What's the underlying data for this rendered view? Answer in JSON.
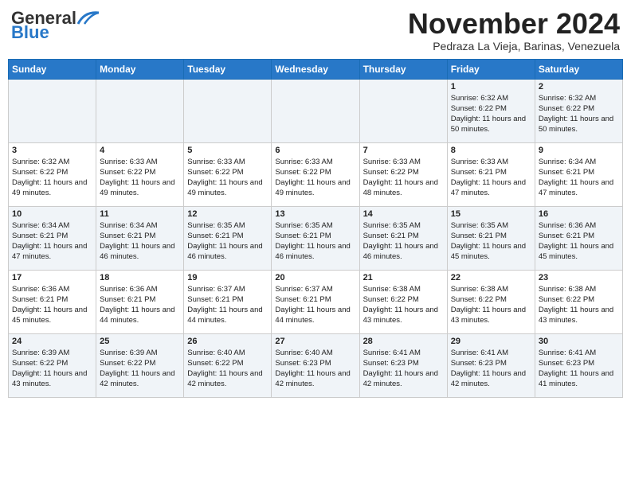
{
  "header": {
    "logo_line1": "General",
    "logo_line2": "Blue",
    "month_title": "November 2024",
    "location": "Pedraza La Vieja, Barinas, Venezuela"
  },
  "days_of_week": [
    "Sunday",
    "Monday",
    "Tuesday",
    "Wednesday",
    "Thursday",
    "Friday",
    "Saturday"
  ],
  "weeks": [
    [
      {
        "day": "",
        "info": ""
      },
      {
        "day": "",
        "info": ""
      },
      {
        "day": "",
        "info": ""
      },
      {
        "day": "",
        "info": ""
      },
      {
        "day": "",
        "info": ""
      },
      {
        "day": "1",
        "info": "Sunrise: 6:32 AM\nSunset: 6:22 PM\nDaylight: 11 hours and 50 minutes."
      },
      {
        "day": "2",
        "info": "Sunrise: 6:32 AM\nSunset: 6:22 PM\nDaylight: 11 hours and 50 minutes."
      }
    ],
    [
      {
        "day": "3",
        "info": "Sunrise: 6:32 AM\nSunset: 6:22 PM\nDaylight: 11 hours and 49 minutes."
      },
      {
        "day": "4",
        "info": "Sunrise: 6:33 AM\nSunset: 6:22 PM\nDaylight: 11 hours and 49 minutes."
      },
      {
        "day": "5",
        "info": "Sunrise: 6:33 AM\nSunset: 6:22 PM\nDaylight: 11 hours and 49 minutes."
      },
      {
        "day": "6",
        "info": "Sunrise: 6:33 AM\nSunset: 6:22 PM\nDaylight: 11 hours and 49 minutes."
      },
      {
        "day": "7",
        "info": "Sunrise: 6:33 AM\nSunset: 6:22 PM\nDaylight: 11 hours and 48 minutes."
      },
      {
        "day": "8",
        "info": "Sunrise: 6:33 AM\nSunset: 6:21 PM\nDaylight: 11 hours and 47 minutes."
      },
      {
        "day": "9",
        "info": "Sunrise: 6:34 AM\nSunset: 6:21 PM\nDaylight: 11 hours and 47 minutes."
      }
    ],
    [
      {
        "day": "10",
        "info": "Sunrise: 6:34 AM\nSunset: 6:21 PM\nDaylight: 11 hours and 47 minutes."
      },
      {
        "day": "11",
        "info": "Sunrise: 6:34 AM\nSunset: 6:21 PM\nDaylight: 11 hours and 46 minutes."
      },
      {
        "day": "12",
        "info": "Sunrise: 6:35 AM\nSunset: 6:21 PM\nDaylight: 11 hours and 46 minutes."
      },
      {
        "day": "13",
        "info": "Sunrise: 6:35 AM\nSunset: 6:21 PM\nDaylight: 11 hours and 46 minutes."
      },
      {
        "day": "14",
        "info": "Sunrise: 6:35 AM\nSunset: 6:21 PM\nDaylight: 11 hours and 46 minutes."
      },
      {
        "day": "15",
        "info": "Sunrise: 6:35 AM\nSunset: 6:21 PM\nDaylight: 11 hours and 45 minutes."
      },
      {
        "day": "16",
        "info": "Sunrise: 6:36 AM\nSunset: 6:21 PM\nDaylight: 11 hours and 45 minutes."
      }
    ],
    [
      {
        "day": "17",
        "info": "Sunrise: 6:36 AM\nSunset: 6:21 PM\nDaylight: 11 hours and 45 minutes."
      },
      {
        "day": "18",
        "info": "Sunrise: 6:36 AM\nSunset: 6:21 PM\nDaylight: 11 hours and 44 minutes."
      },
      {
        "day": "19",
        "info": "Sunrise: 6:37 AM\nSunset: 6:21 PM\nDaylight: 11 hours and 44 minutes."
      },
      {
        "day": "20",
        "info": "Sunrise: 6:37 AM\nSunset: 6:21 PM\nDaylight: 11 hours and 44 minutes."
      },
      {
        "day": "21",
        "info": "Sunrise: 6:38 AM\nSunset: 6:22 PM\nDaylight: 11 hours and 43 minutes."
      },
      {
        "day": "22",
        "info": "Sunrise: 6:38 AM\nSunset: 6:22 PM\nDaylight: 11 hours and 43 minutes."
      },
      {
        "day": "23",
        "info": "Sunrise: 6:38 AM\nSunset: 6:22 PM\nDaylight: 11 hours and 43 minutes."
      }
    ],
    [
      {
        "day": "24",
        "info": "Sunrise: 6:39 AM\nSunset: 6:22 PM\nDaylight: 11 hours and 43 minutes."
      },
      {
        "day": "25",
        "info": "Sunrise: 6:39 AM\nSunset: 6:22 PM\nDaylight: 11 hours and 42 minutes."
      },
      {
        "day": "26",
        "info": "Sunrise: 6:40 AM\nSunset: 6:22 PM\nDaylight: 11 hours and 42 minutes."
      },
      {
        "day": "27",
        "info": "Sunrise: 6:40 AM\nSunset: 6:23 PM\nDaylight: 11 hours and 42 minutes."
      },
      {
        "day": "28",
        "info": "Sunrise: 6:41 AM\nSunset: 6:23 PM\nDaylight: 11 hours and 42 minutes."
      },
      {
        "day": "29",
        "info": "Sunrise: 6:41 AM\nSunset: 6:23 PM\nDaylight: 11 hours and 42 minutes."
      },
      {
        "day": "30",
        "info": "Sunrise: 6:41 AM\nSunset: 6:23 PM\nDaylight: 11 hours and 41 minutes."
      }
    ]
  ]
}
